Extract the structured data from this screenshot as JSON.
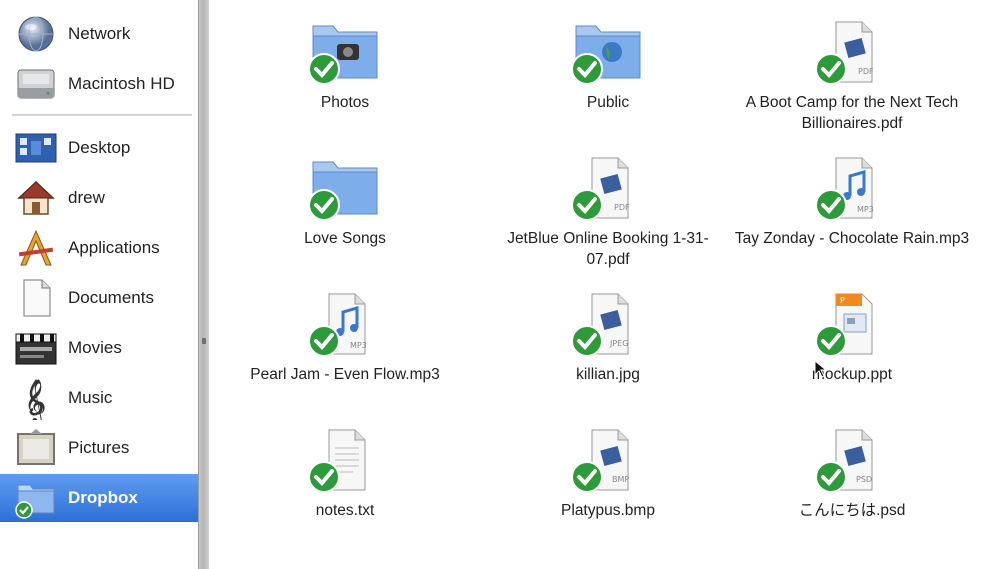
{
  "sidebar": {
    "items": [
      {
        "label": "Network",
        "icon": "network-globe-icon"
      },
      {
        "label": "Macintosh HD",
        "icon": "hard-drive-icon"
      },
      {
        "label": "Desktop",
        "icon": "desktop-icon"
      },
      {
        "label": "drew",
        "icon": "home-icon"
      },
      {
        "label": "Applications",
        "icon": "applications-icon"
      },
      {
        "label": "Documents",
        "icon": "documents-icon"
      },
      {
        "label": "Movies",
        "icon": "movies-clapper-icon"
      },
      {
        "label": "Music",
        "icon": "music-clef-icon"
      },
      {
        "label": "Pictures",
        "icon": "pictures-frame-icon"
      },
      {
        "label": "Dropbox",
        "icon": "dropbox-folder-icon",
        "selected": true
      }
    ],
    "selected_color": "#3a7ee0"
  },
  "files": [
    {
      "name": "Photos",
      "kind": "folder-photos"
    },
    {
      "name": "Public",
      "kind": "folder-public"
    },
    {
      "name": "A Boot Camp for the Next Tech Billionaires.pdf",
      "kind": "pdf",
      "ext": "PDF"
    },
    {
      "name": "Love Songs",
      "kind": "folder"
    },
    {
      "name": "JetBlue Online Booking 1-31-07.pdf",
      "kind": "pdf",
      "ext": "PDF"
    },
    {
      "name": "Tay Zonday - Chocolate Rain.mp3",
      "kind": "mp3",
      "ext": "MP3"
    },
    {
      "name": "Pearl Jam - Even Flow.mp3",
      "kind": "mp3",
      "ext": "MP3"
    },
    {
      "name": "killian.jpg",
      "kind": "jpg",
      "ext": "JPEG"
    },
    {
      "name": "mockup.ppt",
      "kind": "ppt",
      "ext": "P"
    },
    {
      "name": "notes.txt",
      "kind": "txt",
      "ext": ""
    },
    {
      "name": "Platypus.bmp",
      "kind": "bmp",
      "ext": "BMP"
    },
    {
      "name": "こんにちは.psd",
      "kind": "psd",
      "ext": "PSD"
    }
  ],
  "sync_badge_color": "#2e9b3a"
}
